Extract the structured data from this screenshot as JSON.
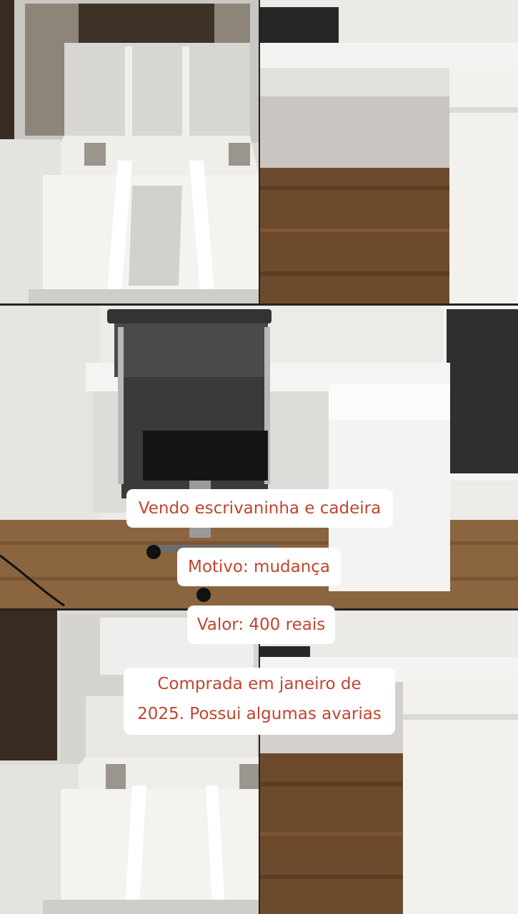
{
  "captions": {
    "line1": "Vendo escrivaninha e cadeira",
    "line2": "Motivo: mudança",
    "line3": "Valor: 400 reais",
    "line4a": "Comprada em janeiro de",
    "line4b": "2025. Possui algumas avarias"
  },
  "colors": {
    "caption_text": "#c0452e",
    "caption_background": "#ffffff",
    "desk_white": "#e9e8e6",
    "floor_wood": "#6e4a2c"
  }
}
